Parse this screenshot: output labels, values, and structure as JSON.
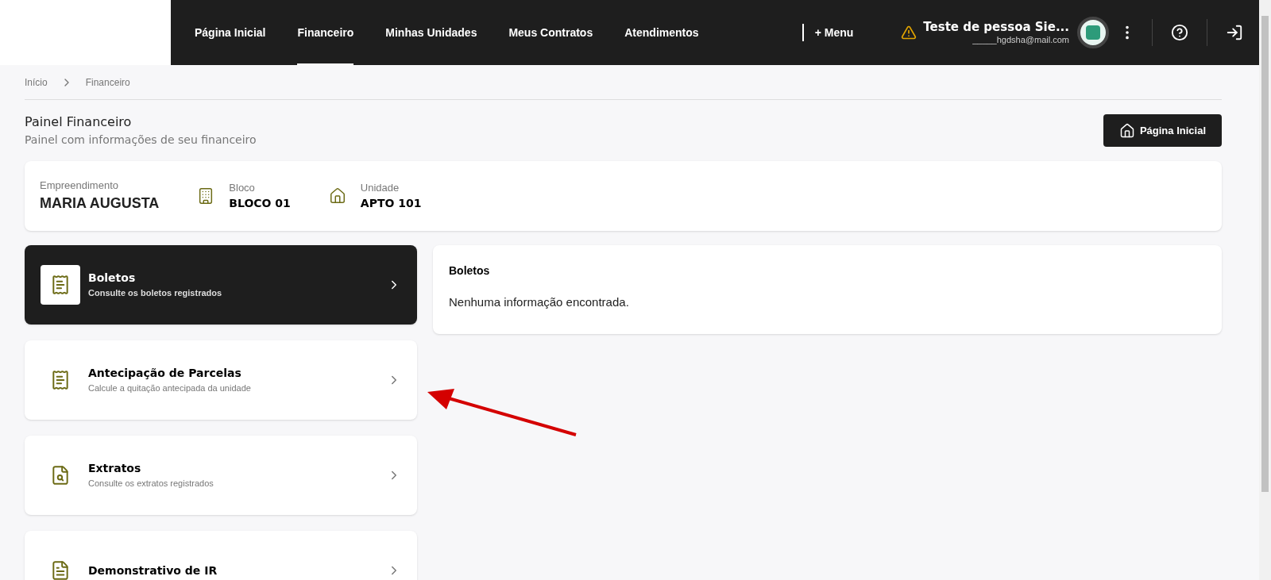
{
  "nav": {
    "items": [
      {
        "label": "Página Inicial",
        "selected": false
      },
      {
        "label": "Financeiro",
        "selected": true
      },
      {
        "label": "Minhas Unidades",
        "selected": false
      },
      {
        "label": "Meus Contratos",
        "selected": false
      },
      {
        "label": "Atendimentos",
        "selected": false
      }
    ],
    "menu": "+ Menu",
    "user": {
      "name": "Teste de pessoa Sie...",
      "email": "_____hgdsha@mail.com",
      "warning": true
    }
  },
  "breadcrumb": [
    "Início",
    "Financeiro"
  ],
  "page": {
    "title": "Painel Financeiro",
    "subtitle": "Painel com informações de seu financeiro",
    "home_button": "Página Inicial"
  },
  "info": [
    {
      "kind": "plain",
      "label": "Empreendimento",
      "value": "MARIA AUGUSTA"
    },
    {
      "kind": "building",
      "label": "Bloco",
      "value": "BLOCO 01"
    },
    {
      "kind": "house",
      "label": "Unidade",
      "value": "APTO 101"
    }
  ],
  "menu_cards": [
    {
      "kind": "receipt",
      "title": "Boletos",
      "subtitle": "Consulte os boletos registrados",
      "selected": true
    },
    {
      "kind": "receipt",
      "title": "Antecipação de Parcelas",
      "subtitle": "Calcule a quitação antecipada da unidade",
      "selected": false
    },
    {
      "kind": "document-search",
      "title": "Extratos",
      "subtitle": "Consulte os extratos registrados",
      "selected": false
    },
    {
      "kind": "document",
      "title": "Demonstrativo de IR",
      "selected": false
    }
  ],
  "detail": {
    "title": "Boletos",
    "message": "Nenhuma informação encontrada."
  }
}
